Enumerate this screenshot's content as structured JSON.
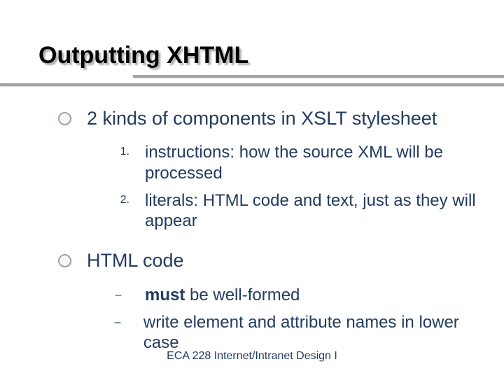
{
  "title": "Outputting XHTML",
  "bullets": [
    {
      "text": "2 kinds of components in XSLT stylesheet",
      "sub_type": "num",
      "sub": [
        "instructions: how the source XML will be processed",
        "literals: HTML code and text, just as they will appear"
      ]
    },
    {
      "text": "HTML code",
      "sub_type": "dash",
      "sub_rich": [
        {
          "bold": "must",
          "rest": " be well-formed"
        },
        {
          "bold": "",
          "rest": "write element and attribute names in lower case"
        }
      ]
    }
  ],
  "footer": "ECA 228  Internet/Intranet Design I"
}
